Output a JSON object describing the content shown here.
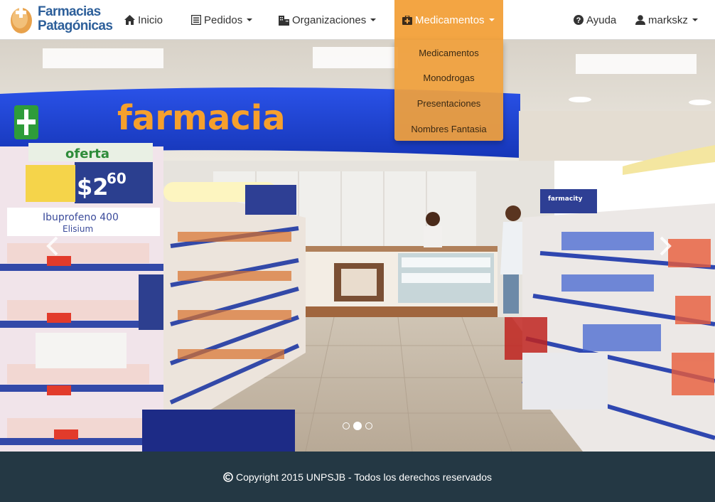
{
  "brand": {
    "line1": "Farmacias",
    "line2": "Patagónicas",
    "logo_icon": "pill-cross-logo"
  },
  "nav": {
    "inicio": {
      "label": "Inicio",
      "icon": "home-icon"
    },
    "pedidos": {
      "label": "Pedidos",
      "icon": "list-alt-icon"
    },
    "organizaciones": {
      "label": "Organizaciones",
      "icon": "building-icon"
    },
    "medicamentos": {
      "label": "Medicamentos",
      "icon": "medkit-icon",
      "active": true
    },
    "ayuda": {
      "label": "Ayuda",
      "icon": "question-circle-icon"
    },
    "user": {
      "label": "markskz",
      "icon": "user-icon"
    }
  },
  "dropdown": {
    "items": [
      "Medicamentos",
      "Monodrogas",
      "Presentaciones",
      "Nombres Fantasia"
    ]
  },
  "carousel": {
    "slide_sign": "farmacia",
    "slide_offer_tag": "oferta",
    "slide_price": "$2",
    "slide_price_cents": "60",
    "slide_product": "Ibuprofeno 400",
    "slide_product_brand": "Elisium",
    "slide_store_sign": "farmacity",
    "slides_count": 3,
    "active_slide": 2
  },
  "footer": {
    "text": "Copyright 2015 UNPSJB - Todos los derechos reservados",
    "icon": "copyright-icon"
  },
  "colors": {
    "accent": "#f3a543",
    "brand": "#2d5f9a",
    "footer_bg": "#243844",
    "sign_blue": "#1a3fd6",
    "sign_text": "#f6a02c"
  }
}
